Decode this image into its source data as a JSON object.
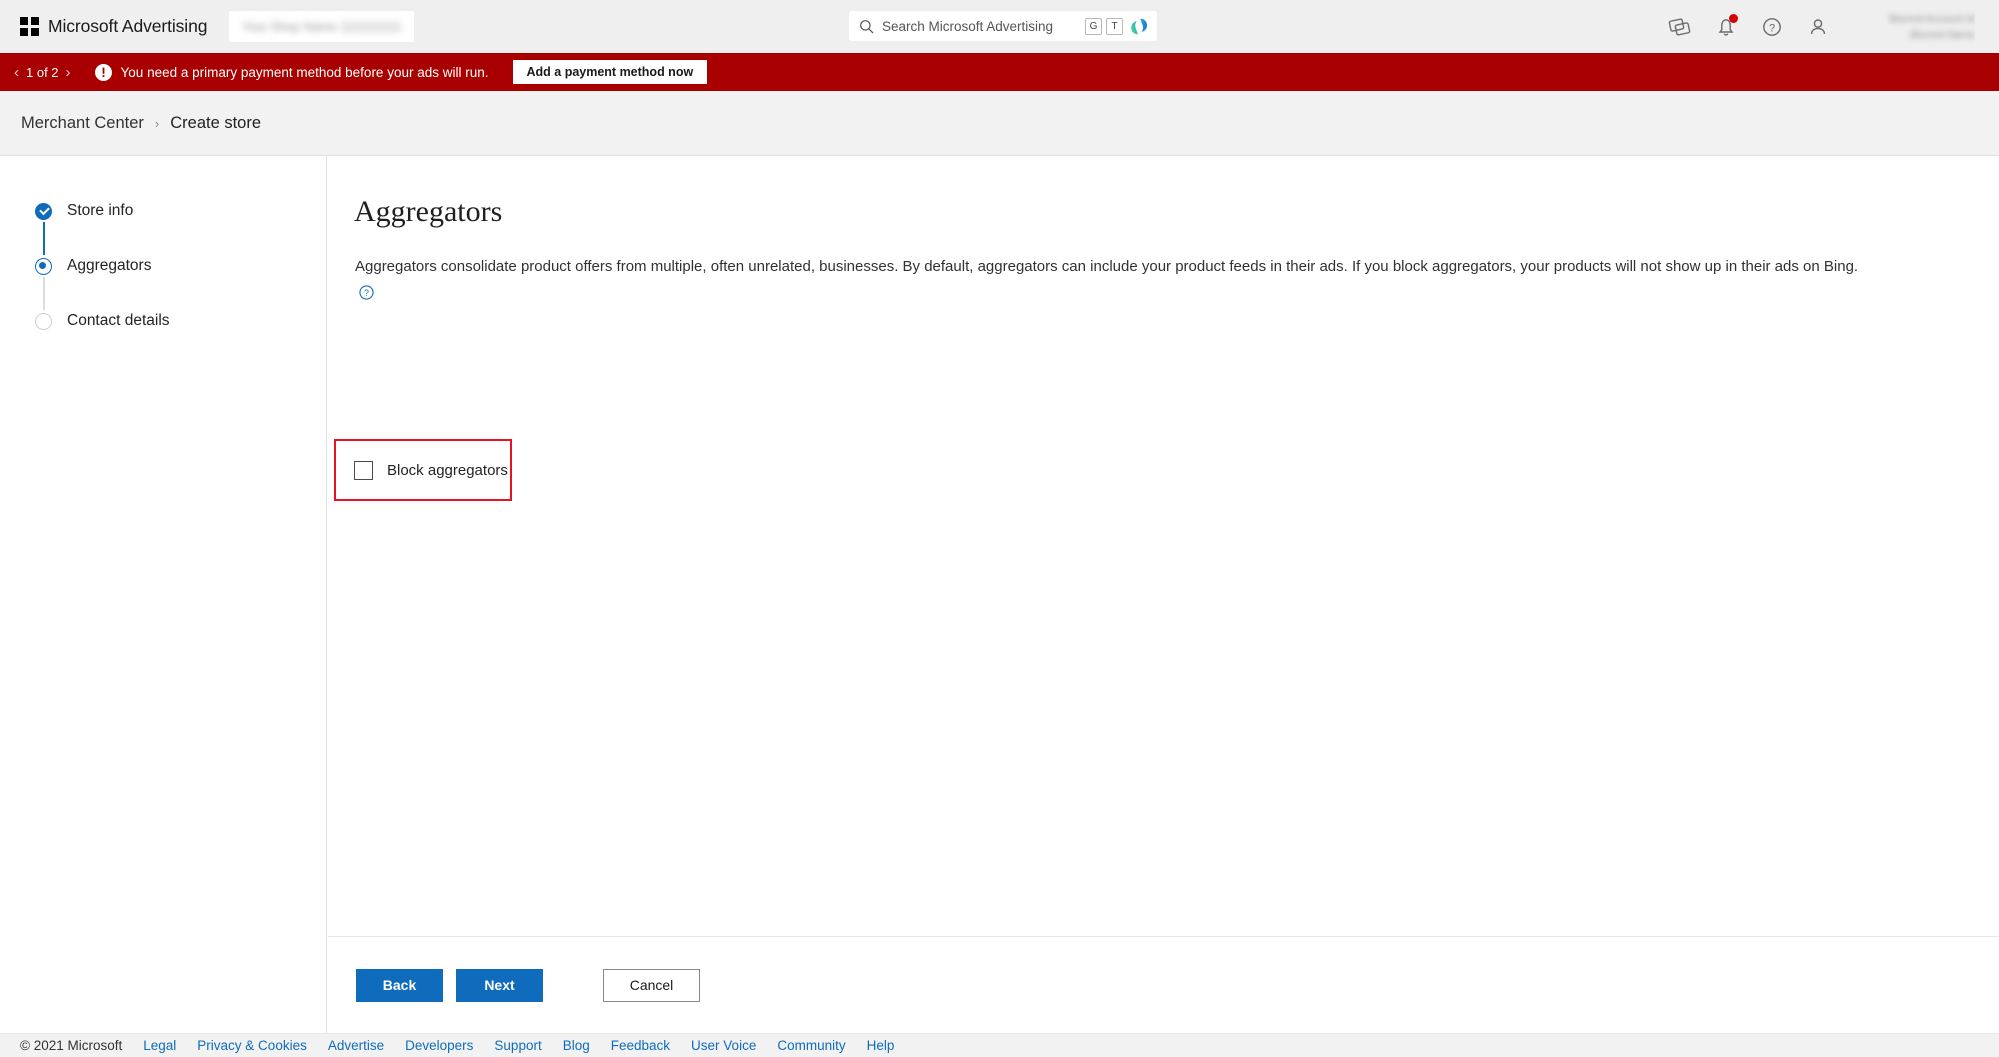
{
  "topbar": {
    "brand": "Microsoft Advertising",
    "account_field_blurred": "Your Shop Name 1111111111",
    "search": {
      "placeholder": "Search Microsoft Advertising",
      "shortcut_badges": [
        "G",
        "T"
      ],
      "icon": "search-icon",
      "copilot_icon": "copilot-icon"
    },
    "icons": [
      {
        "name": "feedback-icon"
      },
      {
        "name": "notifications-bell-icon",
        "has_badge": true
      },
      {
        "name": "help-circle-icon"
      },
      {
        "name": "account-person-icon"
      }
    ],
    "account_blurred_lines": [
      "Blurred Account Id",
      "Blurred Name"
    ]
  },
  "alert": {
    "pager": "1 of 2",
    "prev_label": "‹",
    "next_label": "›",
    "icon": "alert-exclamation-icon",
    "message": "You need a primary payment method before your ads will run.",
    "action_label": "Add a payment method now",
    "background": "#a80000"
  },
  "breadcrumb": {
    "root": "Merchant Center",
    "separator": "›",
    "current": "Create store"
  },
  "stepper": {
    "items": [
      {
        "label": "Store info",
        "state": "completed"
      },
      {
        "label": "Aggregators",
        "state": "current"
      },
      {
        "label": "Contact details",
        "state": "pending"
      }
    ]
  },
  "main": {
    "title": "Aggregators",
    "description": "Aggregators consolidate product offers from multiple, often unrelated, businesses. By default, aggregators can include your product feeds in their ads. If you block aggregators, your products will not show up in their ads on Bing.",
    "description_help_icon": "help-circle-icon",
    "checkbox": {
      "label": "Block aggregators",
      "checked": false,
      "highlight_color": "#e81123"
    }
  },
  "actions": {
    "back_label": "Back",
    "next_label": "Next",
    "cancel_label": "Cancel",
    "primary_color": "#0f6cbd"
  },
  "footer": {
    "copyright": "© 2021 Microsoft",
    "links": [
      "Legal",
      "Privacy & Cookies",
      "Advertise",
      "Developers",
      "Support",
      "Blog",
      "Feedback",
      "User Voice",
      "Community",
      "Help"
    ]
  }
}
